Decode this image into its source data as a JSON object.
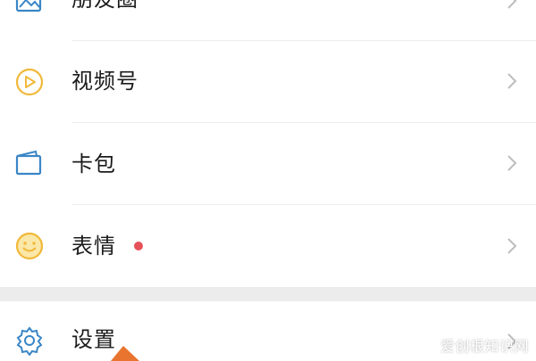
{
  "menu": {
    "items": [
      {
        "label": "朋友圈",
        "icon": "moments-icon"
      },
      {
        "label": "视频号",
        "icon": "channels-play-icon"
      },
      {
        "label": "卡包",
        "icon": "card-wallet-icon"
      },
      {
        "label": "表情",
        "icon": "smiley-icon",
        "has_badge": true
      },
      {
        "label": "设置",
        "icon": "gear-icon"
      }
    ]
  },
  "colors": {
    "icon_blue": "#3a86c6",
    "icon_yellow": "#f0b93a",
    "badge_red": "#e7515a",
    "pointer_orange": "#e9742f",
    "section_gap": "#ececec"
  },
  "watermark": "爱创根知识网"
}
